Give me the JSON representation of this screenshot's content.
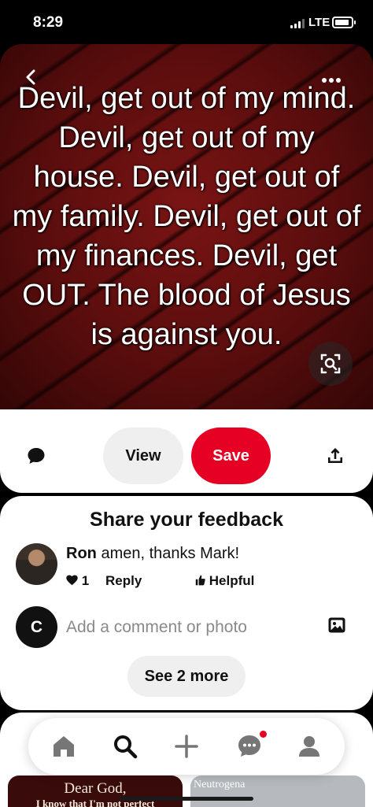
{
  "status_bar": {
    "time": "8:29",
    "network": "LTE"
  },
  "pin": {
    "quote": "Devil, get out of my mind. Devil, get out of my house. Devil, get out of my family. Devil, get out of my finances. Devil, get OUT. The blood of Jesus is against you."
  },
  "actions": {
    "view_label": "View",
    "save_label": "Save"
  },
  "colors": {
    "save": "#e60023",
    "pill_bg": "#efefef"
  },
  "feedback": {
    "title": "Share your feedback",
    "comment": {
      "author": "Ron",
      "text": " amen, thanks Mark!",
      "likes": "1",
      "reply_label": "Reply",
      "helpful_label": "Helpful"
    },
    "user_initial": "C",
    "input_placeholder": "Add a comment or photo",
    "see_more_label": "See 2 more"
  },
  "feed": {
    "left_card_title": "Dear God,",
    "left_card_text": "I know that I'm not perfect",
    "right_card_brand": "Neutrogena"
  },
  "icons": [
    "back-arrow-icon",
    "more-icon",
    "visual-search-icon",
    "comment-icon",
    "share-icon",
    "photo-icon",
    "heart-icon",
    "thumbs-up-icon",
    "home-icon",
    "search-icon",
    "plus-icon",
    "messages-icon",
    "profile-icon"
  ]
}
